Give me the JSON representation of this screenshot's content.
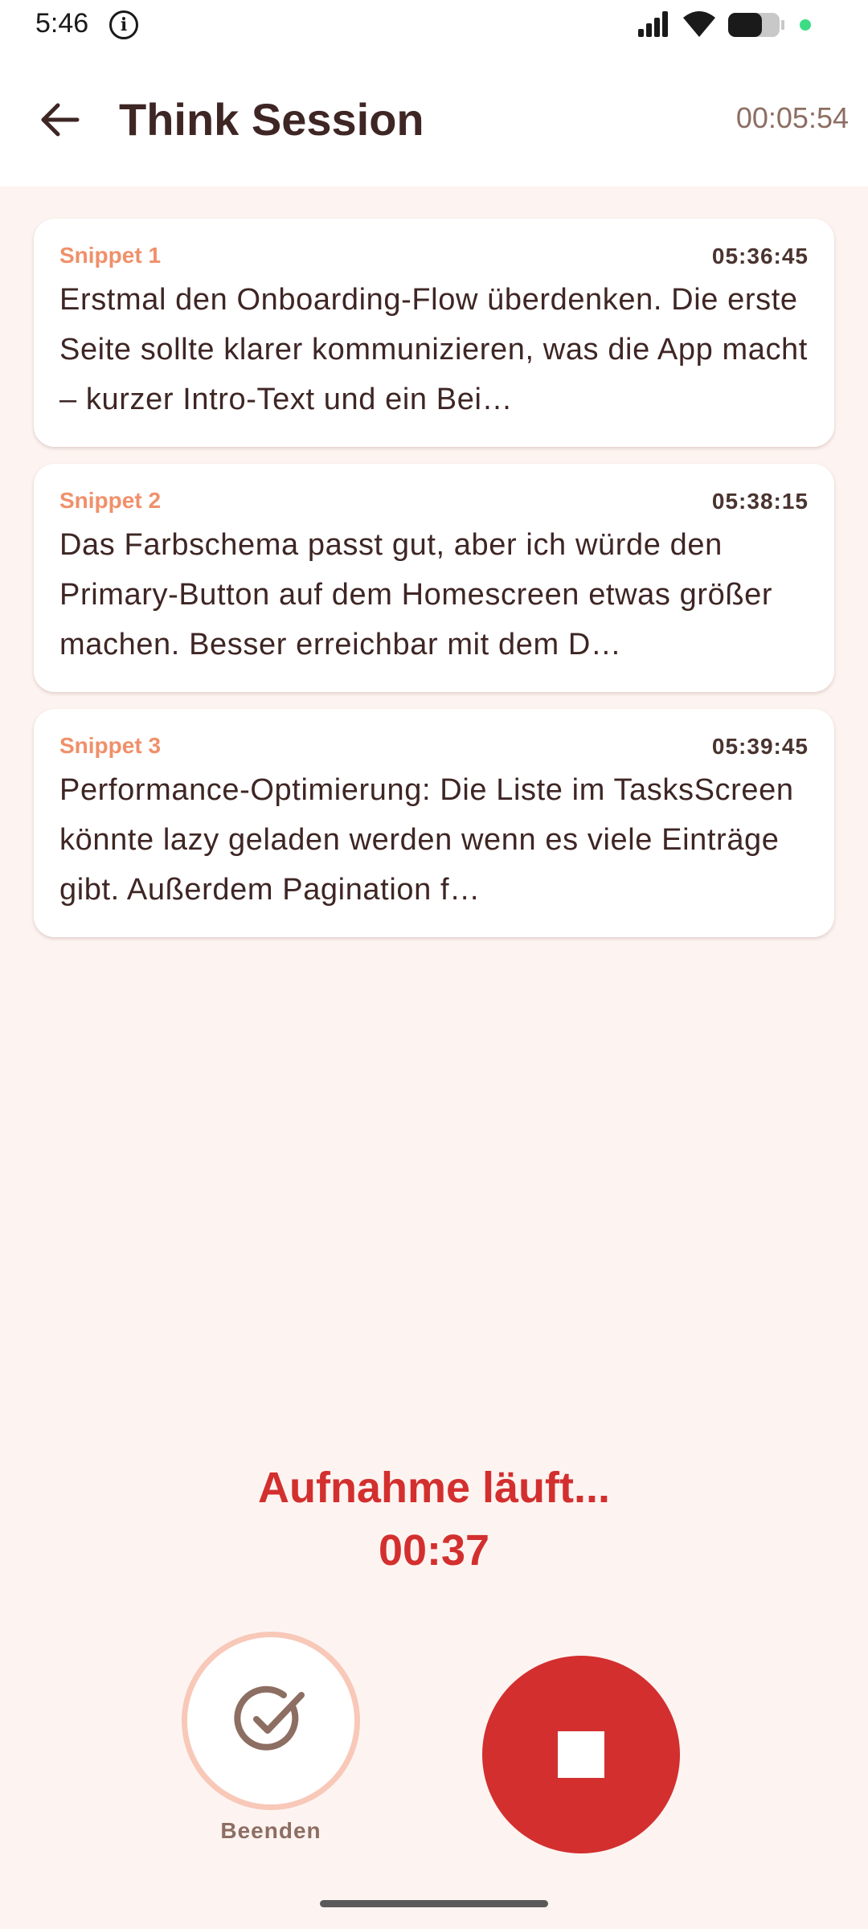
{
  "status_bar": {
    "time": "5:46",
    "icons": [
      "info-icon",
      "signal-icon",
      "wifi-icon",
      "battery-icon",
      "camera-dot-icon"
    ]
  },
  "app_bar": {
    "title": "Think Session",
    "session_timer": "00:05:54",
    "back_icon": "arrow-left-icon"
  },
  "snippets": [
    {
      "label": "Snippet 1",
      "time": "05:36:45",
      "text": "Erstmal den Onboarding-Flow überdenken. Die erste Seite sollte klarer kommunizieren, was die App macht – kurzer Intro-Text und ein Bei…"
    },
    {
      "label": "Snippet 2",
      "time": "05:38:15",
      "text": "Das Farbschema passt gut, aber ich würde den Primary-Button auf dem Homescreen etwas größer machen. Besser erreichbar mit dem D…"
    },
    {
      "label": "Snippet 3",
      "time": "05:39:45",
      "text": "Performance-Optimierung: Die Liste im TasksScreen könnte lazy geladen werden wenn es viele Einträge gibt. Außerdem Pagination f…"
    }
  ],
  "recording": {
    "status": "Aufnahme läuft...",
    "timer": "00:37"
  },
  "controls": {
    "finish_label": "Beenden",
    "finish_icon": "check-circle-icon",
    "stop_icon": "stop-icon"
  },
  "colors": {
    "accent_red": "#d32f2f",
    "snippet_label": "#f0906a",
    "background": "#fdf4f1",
    "text_primary": "#3e2624",
    "text_secondary": "#8d6e63"
  }
}
